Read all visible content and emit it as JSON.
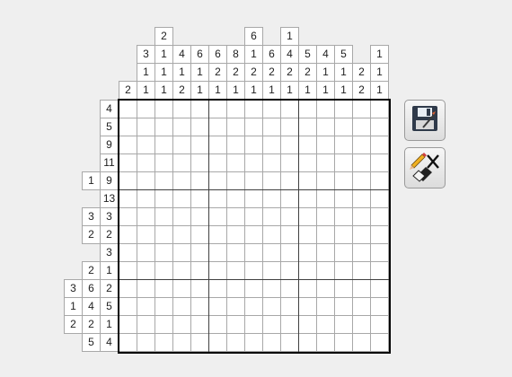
{
  "puzzle": {
    "columns": 15,
    "rows": 14,
    "column_clues": [
      [
        "2"
      ],
      [
        "3",
        "1",
        "1"
      ],
      [
        "2",
        "1",
        "1",
        "1"
      ],
      [
        "4",
        "1",
        "2"
      ],
      [
        "6",
        "1",
        "1"
      ],
      [
        "6",
        "2",
        "1"
      ],
      [
        "8",
        "2",
        "1"
      ],
      [
        "6",
        "1",
        "2",
        "1"
      ],
      [
        "6",
        "2",
        "1"
      ],
      [
        "1",
        "4",
        "2",
        "1"
      ],
      [
        "5",
        "2",
        "1"
      ],
      [
        "4",
        "1",
        "1"
      ],
      [
        "5",
        "1",
        "1"
      ],
      [
        "2",
        "2"
      ],
      [
        "1",
        "1",
        "1"
      ]
    ],
    "row_clues": [
      [
        "4"
      ],
      [
        "5"
      ],
      [
        "9"
      ],
      [
        "11"
      ],
      [
        "1",
        "9"
      ],
      [
        "13"
      ],
      [
        "3",
        "3"
      ],
      [
        "2",
        "2"
      ],
      [
        "3"
      ],
      [
        "2",
        "1"
      ],
      [
        "3",
        "6",
        "2"
      ],
      [
        "1",
        "4",
        "5"
      ],
      [
        "2",
        "2",
        "1"
      ],
      [
        "5",
        "4"
      ]
    ]
  },
  "toolbar": {
    "save_icon": "floppy-disk-icon",
    "clear_icon": "pencil-eraser-clear-icon"
  }
}
